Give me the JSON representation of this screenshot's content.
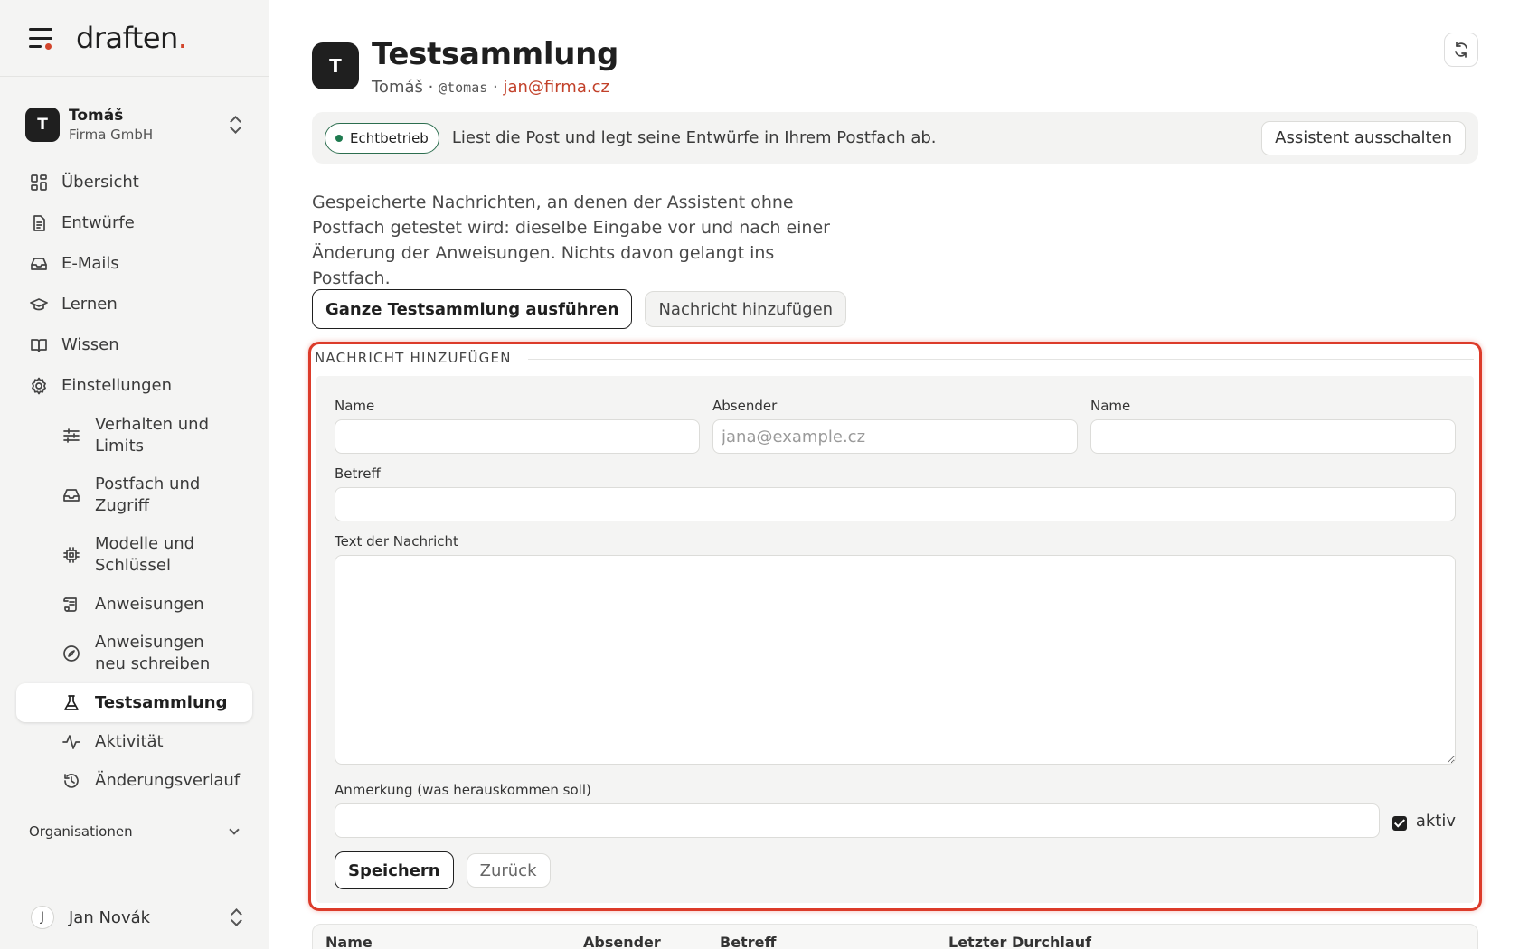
{
  "brand": {
    "logo_text": "draften",
    "logo_dot": ".",
    "accent_color": "#d2452b"
  },
  "workspace": {
    "initial": "T",
    "name": "Tomáš",
    "company": "Firma GmbH"
  },
  "nav": {
    "items": [
      {
        "label": "Übersicht",
        "icon": "grid-icon"
      },
      {
        "label": "Entwürfe",
        "icon": "document-icon"
      },
      {
        "label": "E-Mails",
        "icon": "inbox-icon"
      },
      {
        "label": "Lernen",
        "icon": "graduation-cap-icon"
      },
      {
        "label": "Wissen",
        "icon": "book-icon"
      },
      {
        "label": "Einstellungen",
        "icon": "gear-icon"
      }
    ],
    "sub_items": [
      {
        "label": "Verhalten und Limits",
        "icon": "sliders-icon"
      },
      {
        "label": "Postfach und Zugriff",
        "icon": "inbox-icon"
      },
      {
        "label": "Modelle und Schlüssel",
        "icon": "chip-icon"
      },
      {
        "label": "Anweisungen",
        "icon": "scroll-icon"
      },
      {
        "label": "Anweisungen neu schreiben",
        "icon": "compass-icon"
      },
      {
        "label": "Testsammlung",
        "icon": "flask-icon",
        "active": true
      },
      {
        "label": "Aktivität",
        "icon": "activity-icon"
      },
      {
        "label": "Änderungsverlauf",
        "icon": "history-icon"
      }
    ],
    "org_label": "Organisationen"
  },
  "user": {
    "initial": "J",
    "name": "Jan Novák"
  },
  "header": {
    "initial": "T",
    "title": "Testsammlung",
    "owner": "Tomáš",
    "sep1": " · ",
    "handle": "@tomas",
    "sep2": " · ",
    "email": "jan@firma.cz"
  },
  "status": {
    "badge": "Echtbetrieb",
    "badge_color": "#1e7a4f",
    "text": "Liest die Post und legt seine Entwürfe in Ihrem Postfach ab.",
    "button": "Assistent ausschalten"
  },
  "description": "Gespeicherte Nachrichten, an denen der Assistent ohne Postfach getestet wird: dieselbe Eingabe vor und nach einer Änderung der Anweisungen. Nichts davon gelangt ins Postfach.",
  "actions": {
    "run_all": "Ganze Testsammlung ausführen",
    "add_message": "Nachricht hinzufügen"
  },
  "form": {
    "legend": "NACHRICHT HINZUFÜGEN",
    "name_label": "Name",
    "name_value": "",
    "sender_label": "Absender",
    "sender_placeholder": "jana@example.cz",
    "name2_label": "Name",
    "name2_value": "",
    "subject_label": "Betreff",
    "subject_value": "",
    "body_label": "Text der Nachricht",
    "body_value": "",
    "note_label": "Anmerkung (was herauskommen soll)",
    "note_value": "",
    "active_label": "aktiv",
    "active_checked": true,
    "save": "Speichern",
    "back": "Zurück",
    "highlight_color": "#dc3b2a"
  },
  "table": {
    "columns": [
      "Name",
      "Absender",
      "Betreff",
      "Letzter Durchlauf"
    ]
  }
}
